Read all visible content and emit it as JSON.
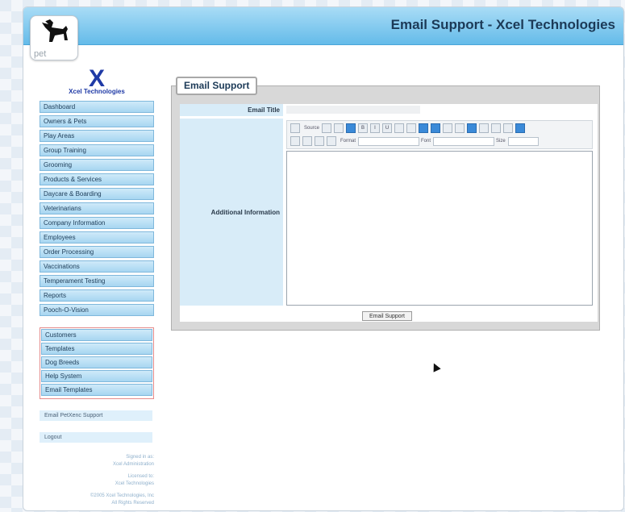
{
  "header": {
    "title": "Email Support - Xcel Technologies",
    "logo_text": "pet"
  },
  "brand": {
    "mark": "X",
    "name": "Xcel Technologies"
  },
  "nav_primary": [
    "Dashboard",
    "Owners & Pets",
    "Play Areas",
    "Group Training",
    "Grooming",
    "Products & Services",
    "Daycare & Boarding",
    "Veterinarians",
    "Company Information",
    "Employees",
    "Order Processing",
    "Vaccinations",
    "Temperament Testing",
    "Reports",
    "Pooch-O-Vision"
  ],
  "nav_secondary": [
    "Customers",
    "Templates",
    "Dog Breeds",
    "Help System",
    "Email Templates"
  ],
  "links": {
    "email_support": "Email PetXenc Support",
    "logout": "Logout"
  },
  "footer": {
    "signed_in_label": "Signed in as:",
    "signed_in_user": "Xcel Administration",
    "licensed_label": "Licensed to:",
    "licensed_to": "Xcel Technologies",
    "copyright": "©2005 Xcel Technologies, Inc",
    "rights": "All Rights Reserved"
  },
  "panel": {
    "tab_label": "Email Support",
    "email_title_label": "Email Title",
    "email_title_value": "",
    "additional_info_label": "Additional Information",
    "submit_label": "Email Support"
  },
  "toolbar": {
    "source_label": "Source",
    "format_label": "Format",
    "font_label": "Font",
    "size_label": "Size"
  },
  "icons": [
    "logo-icon",
    "source-icon",
    "bold-icon",
    "italic-icon",
    "underline-icon",
    "list-icon",
    "align-icon",
    "link-icon",
    "image-icon"
  ],
  "colors": {
    "header_top": "#a9dcf6",
    "header_bottom": "#64bbe9",
    "nav_bg": "#a7d6f1",
    "group_border": "#e58b8b"
  }
}
